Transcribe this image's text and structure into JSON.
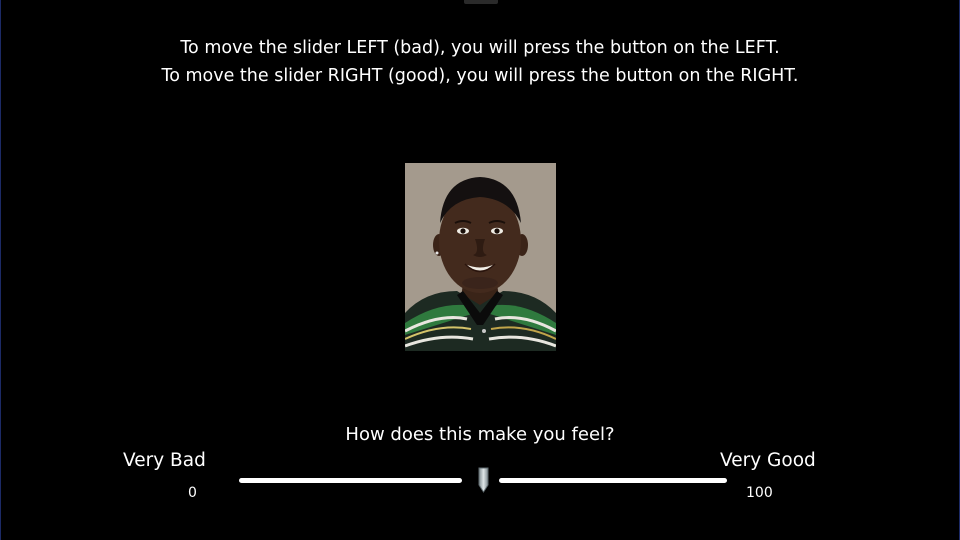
{
  "instructions": {
    "line1": "To move the slider LEFT (bad), you will press the button on the LEFT.",
    "line2": "To move the slider RIGHT (good), you will press the button on the RIGHT."
  },
  "stimulus": {
    "type": "face-photo"
  },
  "rating": {
    "question": "How does this make you feel?",
    "left_label": "Very Bad",
    "right_label": "Very Good",
    "min": "0",
    "max": "100",
    "value_fraction": 0.5
  },
  "colors": {
    "background": "#000000",
    "text": "#ffffff",
    "track": "#ffffff",
    "thumb": "#b8c2c6"
  }
}
